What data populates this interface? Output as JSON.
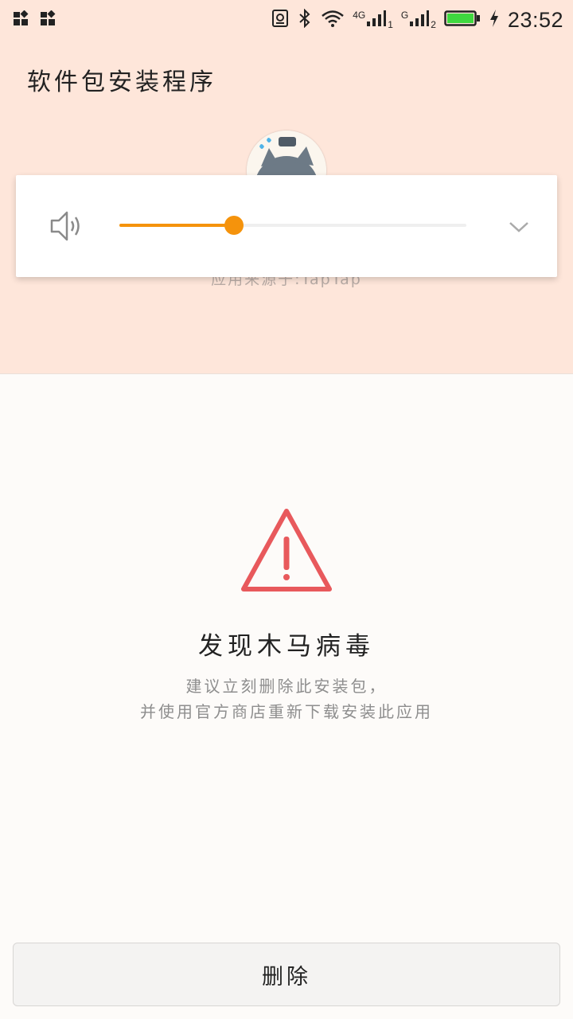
{
  "status_bar": {
    "time": "23:52",
    "network_1": "4G",
    "sim_1": "1",
    "network_2": "G",
    "sim_2": "2",
    "icons": [
      "notification-icon",
      "notification-icon",
      "sim-card-icon",
      "bluetooth-icon",
      "wifi-icon",
      "signal-icon",
      "signal-icon",
      "battery-icon",
      "charging-icon"
    ],
    "battery_level": 0.9
  },
  "header": {
    "title": "软件包安装程序"
  },
  "app": {
    "source": "应用来源于:TapTap",
    "icon": "cat-avatar"
  },
  "volume_panel": {
    "level": 0.33,
    "accent_color": "#f5930c",
    "icons": [
      "speaker-icon",
      "chevron-down-icon"
    ]
  },
  "warning": {
    "icon": "warning-triangle-icon",
    "color": "#e8595c",
    "title": "发现木马病毒",
    "description_line1": "建议立刻删除此安装包，",
    "description_line2": "并使用官方商店重新下载安装此应用"
  },
  "actions": {
    "delete_label": "删除"
  }
}
